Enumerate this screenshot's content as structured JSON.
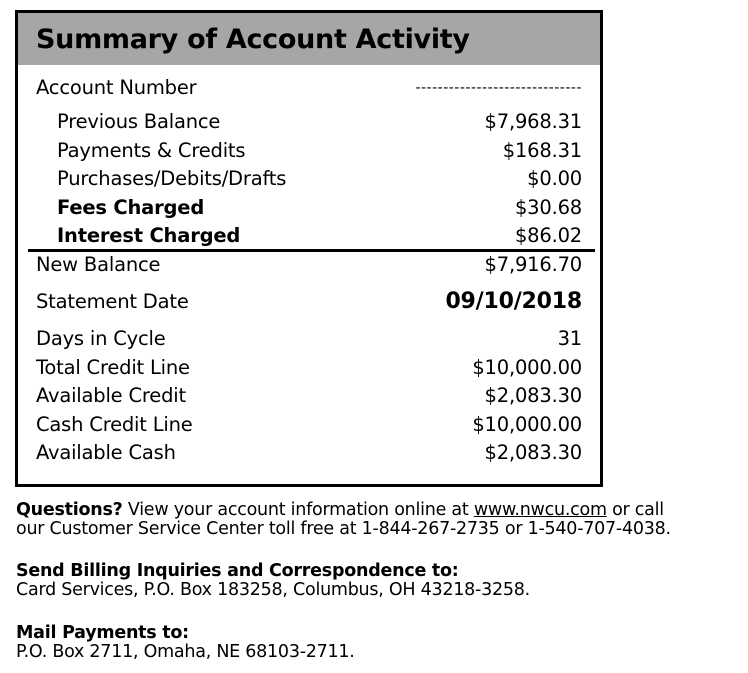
{
  "summary": {
    "title": "Summary of Account Activity",
    "account_number": {
      "label": "Account Number",
      "value": "------------------------------"
    },
    "activity": [
      {
        "label": "Previous Balance",
        "value": "$7,968.31",
        "bold": false
      },
      {
        "label": "Payments & Credits",
        "value": "$168.31",
        "bold": false
      },
      {
        "label": "Purchases/Debits/Drafts",
        "value": "$0.00",
        "bold": false
      },
      {
        "label": "Fees Charged",
        "value": "$30.68",
        "bold": true
      },
      {
        "label": "Interest Charged",
        "value": "$86.02",
        "bold": true
      }
    ],
    "new_balance": {
      "label": "New Balance",
      "value": "$7,916.70"
    },
    "statement_date": {
      "label": "Statement Date",
      "value": "09/10/2018"
    },
    "details": [
      {
        "label": "Days in Cycle",
        "value": "31"
      },
      {
        "label": "Total Credit Line",
        "value": "$10,000.00"
      },
      {
        "label": "Available Credit",
        "value": "$2,083.30"
      },
      {
        "label": "Cash Credit Line",
        "value": "$10,000.00"
      },
      {
        "label": "Available Cash",
        "value": "$2,083.30"
      }
    ]
  },
  "footer": {
    "questions": {
      "heading": "Questions?",
      "text_before_link": " View your account information online at ",
      "link": "www.nwcu.com",
      "text_after_link": " or call",
      "line2": "our Customer Service Center toll free at 1-844-267-2735 or 1-540-707-4038."
    },
    "billing": {
      "heading": "Send Billing Inquiries and Correspondence to:",
      "address": "Card Services, P.O. Box 183258, Columbus, OH 43218-3258."
    },
    "payments": {
      "heading": "Mail Payments to:",
      "address": "P.O. Box 2711, Omaha, NE 68103-2711."
    }
  }
}
